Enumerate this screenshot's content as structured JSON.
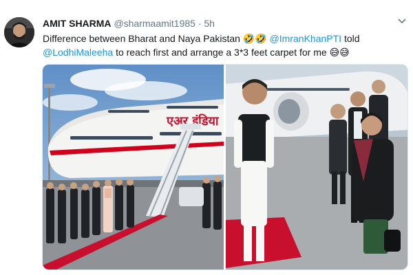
{
  "tweet": {
    "author_name": "AMIT SHARMA",
    "author_handle": "@sharmaamit1985",
    "separator": "·",
    "time": "5h",
    "text_part1": "Difference between Bharat and Naya Pakistan",
    "emoji_rofl": "🤣🤣",
    "mention1": "@ImranKhanPTI",
    "text_part2": "told",
    "mention2": "@LodhiMaleeha",
    "text_part3": "to reach first and arrange a 3*3 feet carpet for me",
    "emoji_sweat": "😅😅",
    "menu_icon": "chevron-down-icon"
  },
  "photos": {
    "left": {
      "aircraft_livery_text": "एअर इंडिया"
    }
  },
  "colors": {
    "mention": "#1b95e0",
    "carpet_red": "#c8102e",
    "air_india_red": "#d0021b"
  }
}
